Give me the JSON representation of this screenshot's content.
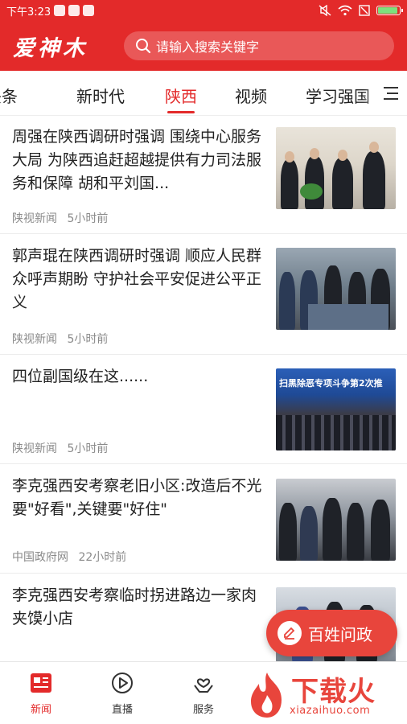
{
  "status_bar": {
    "time": "下午3:23"
  },
  "header": {
    "logo": "爱神木",
    "search_placeholder": "请输入搜索关键字"
  },
  "tabs": [
    {
      "label": "头条"
    },
    {
      "label": "新时代"
    },
    {
      "label": "陕西"
    },
    {
      "label": "视频"
    },
    {
      "label": "学习强国"
    }
  ],
  "active_tab": "陕西",
  "articles": [
    {
      "title": "周强在陕西调研时强调 围绕中心服务大局 为陕西追赶超越提供有力司法服务和保障 胡和平刘国...",
      "source": "陕视新闻",
      "time": "5小时前"
    },
    {
      "title": "郭声琨在陕西调研时强调 顺应人民群众呼声期盼 守护社会平安促进公平正义",
      "source": "陕视新闻",
      "time": "5小时前"
    },
    {
      "title": "四位副国级在这......",
      "source": "陕视新闻",
      "time": "5小时前",
      "thumb_banner": "扫黑除恶专项斗争第2次推"
    },
    {
      "title": "李克强西安考察老旧小区:改造后不光要\"好看\",关键要\"好住\"",
      "source": "中国政府网",
      "time": "22小时前"
    },
    {
      "title": "李克强西安考察临时拐进路边一家肉夹馍小店",
      "source": "",
      "time": ""
    }
  ],
  "float_button": {
    "label": "百姓问政"
  },
  "bottom_nav": [
    {
      "label": "新闻",
      "icon": "news-icon"
    },
    {
      "label": "直播",
      "icon": "play-icon"
    },
    {
      "label": "服务",
      "icon": "service-icon"
    }
  ],
  "watermark": {
    "text": "下载火",
    "sub": "xiazaihuo.com"
  },
  "colors": {
    "brand": "#e32a2a",
    "float": "#e8453c"
  }
}
